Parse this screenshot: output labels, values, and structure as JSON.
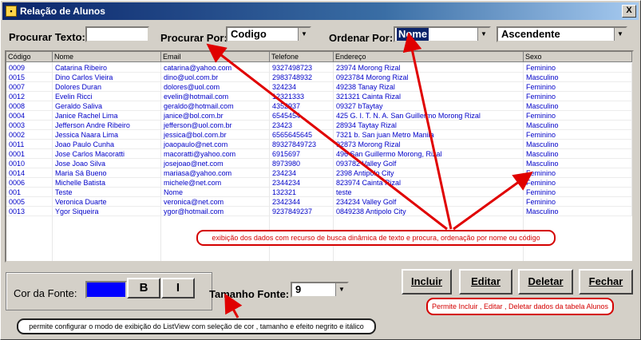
{
  "window": {
    "title": "Relação de Alunos",
    "close_label": "X"
  },
  "search": {
    "label": "Procurar Texto:",
    "value": ""
  },
  "search_by": {
    "label": "Procurar Por:",
    "value": "Codigo"
  },
  "order_by": {
    "label": "Ordenar Por:",
    "value": "Nome"
  },
  "order_dir": {
    "value": "Ascendente"
  },
  "table": {
    "columns": [
      "Código",
      "Nome",
      "Email",
      "Telefone",
      "Endereço",
      "Sexo"
    ],
    "rows": [
      [
        "0009",
        "Catarina Ribeiro",
        "catarina@yahoo.com",
        "9327498723",
        "23974 Morong Rizal",
        "Feminino"
      ],
      [
        "0015",
        "Dino Carlos Vieira",
        "dino@uol.com.br",
        "2983748932",
        "0923784 Morong Rizal",
        "Masculino"
      ],
      [
        "0007",
        "Dolores Duran",
        "dolores@uol.com",
        "324234",
        "49238 Tanay Rizal",
        "Feminino"
      ],
      [
        "0012",
        "Evelin Ricci",
        "evelin@hotmail.com",
        "12321333",
        "321321 Cainta Rizal",
        "Feminino"
      ],
      [
        "0008",
        "Geraldo Saliva",
        "geraldo@hotmail.com",
        "4352937",
        "09327 bTaytay",
        "Masculino"
      ],
      [
        "0004",
        "Janice Rachel Lima",
        "janice@bol.com.br",
        "6545454",
        "425 G. I. T. N. A. San Guillermo Morong Rizal",
        "Feminino"
      ],
      [
        "0003",
        "Jefferson Andre Ribeiro",
        "jefferson@uol.com.br",
        "23423",
        "28934 Taytay Rizal",
        "Masculino"
      ],
      [
        "0002",
        "Jessica Naara Lima",
        "jessica@bol.com.br",
        "6565645645",
        "7321 b. San juan Metro Manila",
        "Feminino"
      ],
      [
        "0011",
        "Joao Paulo Cunha",
        "joaopaulo@net.com",
        "89327849723",
        "92873 Morong Rizal",
        "Masculino"
      ],
      [
        "0001",
        "Jose Carlos Macoratti",
        "macoratti@yahoo.com",
        "6915697",
        "496 San Guillermo Morong, Rizal",
        "Masculino"
      ],
      [
        "0010",
        "Jose Joao Silva",
        "josejoao@net.com",
        "8973980",
        "093782 Valley Golf",
        "Masculino"
      ],
      [
        "0014",
        "Maria Sá Bueno",
        "mariasa@yahoo.com",
        "234234",
        "2398 Antipolo City",
        "Feminino"
      ],
      [
        "0006",
        "Michelle Batista",
        "michele@net.com",
        "2344234",
        "823974 Cainta Rizal",
        "Feminino"
      ],
      [
        "001",
        "Teste",
        "Nome",
        "132321",
        "teste",
        "Feminino"
      ],
      [
        "0005",
        "Veronica Duarte",
        "veronica@net.com",
        "2342344",
        "234234 Valley Golf",
        "Feminino"
      ],
      [
        "0013",
        "Ygor Siqueira",
        "ygor@hotmail.com",
        "9237849237",
        "0849238 Antipolo City",
        "Masculino"
      ]
    ]
  },
  "font_panel": {
    "label": "Cor da Fonte:",
    "color": "#0000ff",
    "bold_label": "B",
    "italic_label": "I"
  },
  "font_size": {
    "label": "Tamanho Fonte:",
    "value": "9"
  },
  "buttons": {
    "include": "Incluir",
    "edit": "Editar",
    "delete": "Deletar",
    "close": "Fechar"
  },
  "notes": {
    "listview": "exibição dos dados com recurso de busca dinâmica de texto e procura, ordenação por nome ou código",
    "crud": "Permite Incluir , Editar , Deletar dados da tabela Alunos",
    "font": "permite configurar o modo de exibição do ListView com seleção de cor , tamanho e efeito negrito e itálico"
  },
  "colors": {
    "title_bar": "#0a246a",
    "data_text": "#0000c8",
    "annotation": "#d40000",
    "window_bg": "#d4d0c8"
  }
}
